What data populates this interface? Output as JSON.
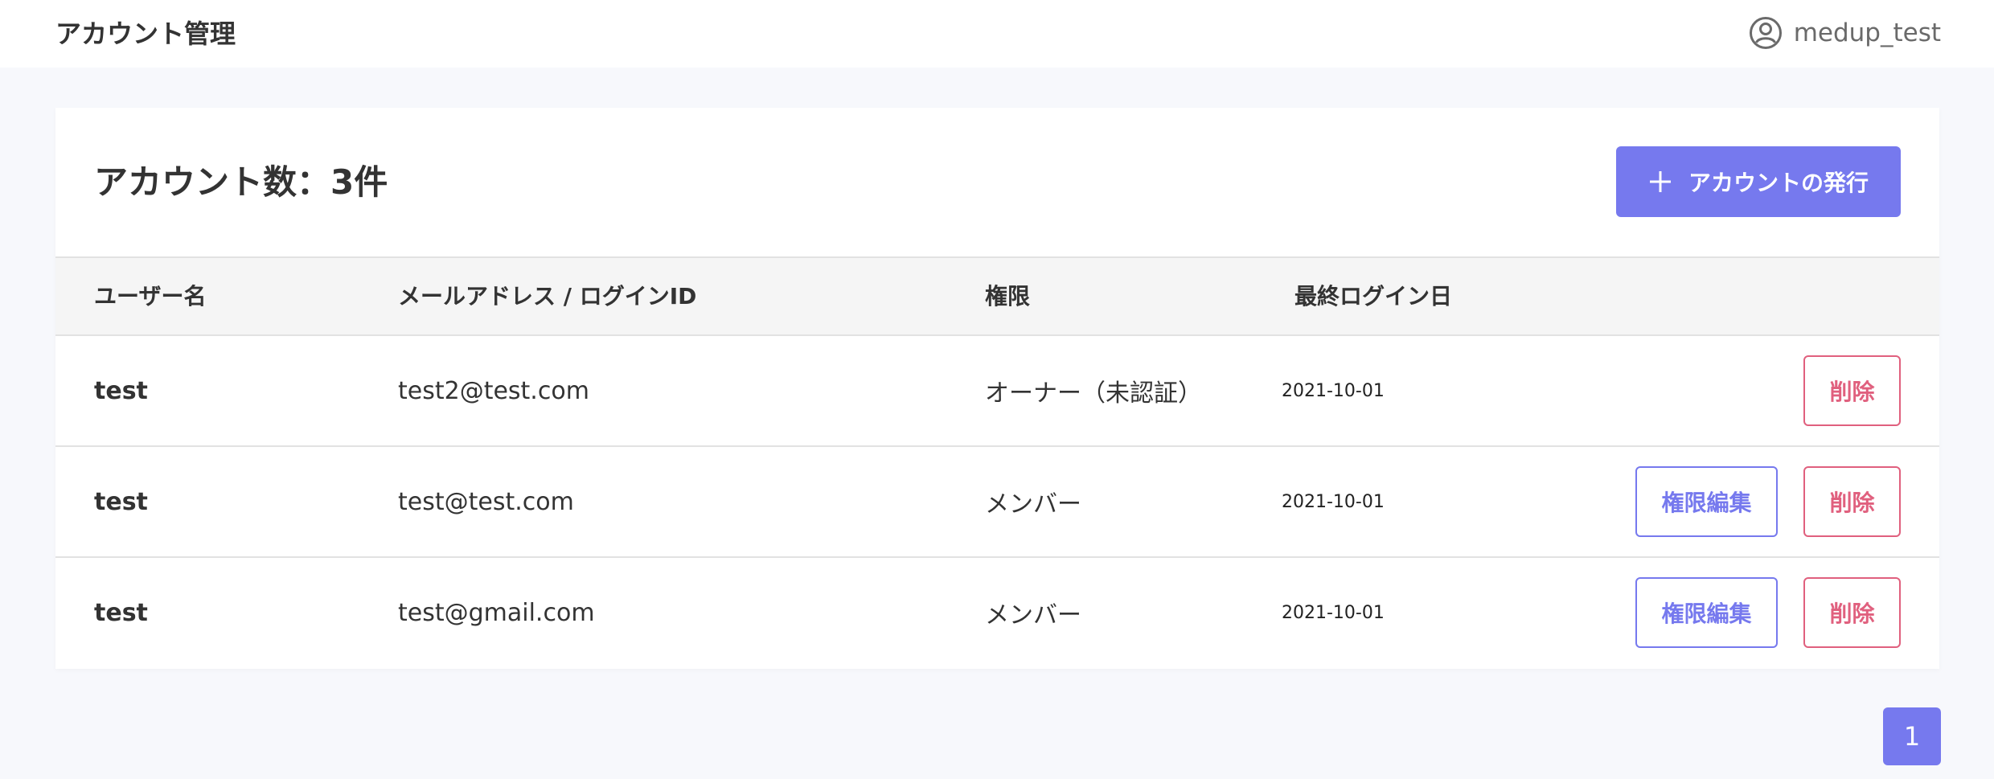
{
  "header": {
    "title": "アカウント管理",
    "user_name": "medup_test",
    "user_icon": "user-circle-icon"
  },
  "card": {
    "count_title": "アカウント数：3件",
    "issue_button_label": "アカウントの発行",
    "issue_button_icon": "plus-icon"
  },
  "table": {
    "columns": [
      "ユーザー名",
      "メールアドレス / ログインID",
      "権限",
      "最終ログイン日"
    ],
    "rows": [
      {
        "user": "test",
        "email": "test2@test.com",
        "role": "オーナー（未認証）",
        "last_login": "2021-10-01",
        "edit_label": null,
        "delete_label": "削除"
      },
      {
        "user": "test",
        "email": "test@test.com",
        "role": "メンバー",
        "last_login": "2021-10-01",
        "edit_label": "権限編集",
        "delete_label": "削除"
      },
      {
        "user": "test",
        "email": "test@gmail.com",
        "role": "メンバー",
        "last_login": "2021-10-01",
        "edit_label": "権限編集",
        "delete_label": "削除"
      }
    ]
  },
  "pagination": {
    "current_page": "1"
  },
  "colors": {
    "accent": "#7679ee",
    "danger": "#e0607e",
    "background": "#f7f8fc",
    "header_row": "#f5f5f5"
  }
}
